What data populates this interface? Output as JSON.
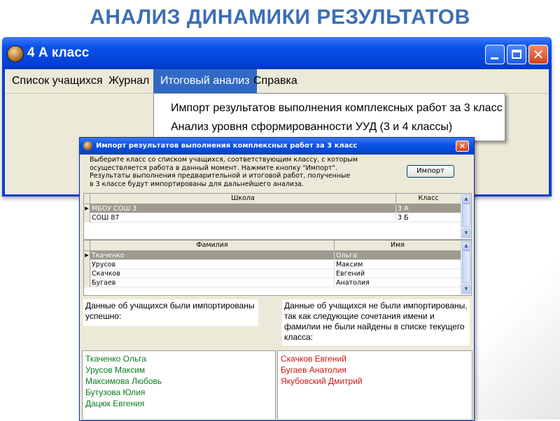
{
  "slide": {
    "title": "АНАЛИЗ ДИНАМИКИ РЕЗУЛЬТАТОВ"
  },
  "main_window": {
    "title": "4 А класс",
    "menu": [
      {
        "label": "Список учащихся"
      },
      {
        "label": "Журнал"
      },
      {
        "label": "Итоговый анализ",
        "active": true
      },
      {
        "label": "Справка"
      }
    ],
    "dropdown_items": [
      {
        "label": "Импорт результатов выполнения комплексных работ за 3 класс"
      },
      {
        "label": "Анализ уровня сформированности УУД (3 и 4 классы)"
      }
    ]
  },
  "dialog": {
    "title": "Импорт результатов выполнения комплексных работ за 3 класс",
    "close_label": "×",
    "instruction": "Выберите класс со списком учащихся, соответствующим классу, с которым\nосуществляется работа в данный момент. Нажмите кнопку \"Импорт\".\nРезультаты выполнения предварительной и итоговой работ, полученные\nв 3 классе будут импортированы для дальнейшего анализа.",
    "import_button": "Импорт",
    "schools_table": {
      "columns": [
        "Школа",
        "Класс"
      ],
      "rows": [
        {
          "school": "МБОУ СОШ 3",
          "class": "3 А",
          "selected": true
        },
        {
          "school": "СОШ 87",
          "class": "3 Б"
        }
      ]
    },
    "students_table": {
      "columns": [
        "Фамилия",
        "Имя"
      ],
      "rows": [
        {
          "last": "Ткаченко",
          "first": "Ольга",
          "selected": true
        },
        {
          "last": "Урусов",
          "first": "Максим"
        },
        {
          "last": "Скачков",
          "first": "Евгений"
        },
        {
          "last": "Бугаев",
          "first": "Анатолия"
        }
      ]
    },
    "imported_note": "Данные об учащихся были импортированы успешно:",
    "not_imported_note": "Данные об учащихся не были импортированы, так как следующие сочетания имени и фамилии не были найдены в списке текущего класса:",
    "imported_list": [
      "Ткаченко Ольга",
      "Урусов Максим",
      "Максимова Любовь",
      "Бутузова Юлия",
      "Дацюк Евгения"
    ],
    "not_imported_list": [
      "Скачков Евгений",
      "Бугаев Анатолия",
      "Якубовский Дмитрий"
    ]
  },
  "colors": {
    "imported_text": "#0a7a1e",
    "not_imported_text": "#cc1212",
    "selection": "#316ac5"
  }
}
